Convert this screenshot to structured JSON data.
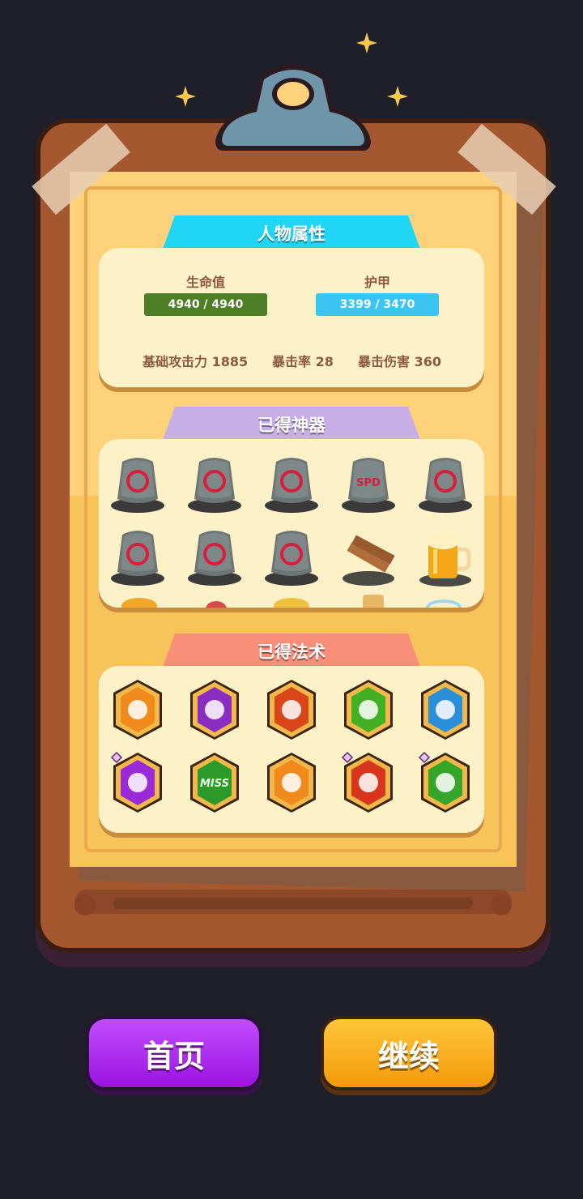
{
  "stats_section": {
    "title": "人物属性",
    "hp_label": "生命值",
    "hp_value": "4940 / 4940",
    "hp_fraction": 1.0,
    "armor_label": "护甲",
    "armor_value": "3399 / 3470",
    "armor_fraction": 0.98,
    "base_attack": "基础攻击力 1885",
    "crit_rate": "暴击率 28",
    "crit_damage": "暴击伤害 360"
  },
  "artifacts_section": {
    "title": "已得神器",
    "items": [
      {
        "icon": "sunrise-rune-icon"
      },
      {
        "icon": "k-rune-icon"
      },
      {
        "icon": "curve-rune-icon"
      },
      {
        "icon": "spd-rune-icon",
        "label": "SPD"
      },
      {
        "icon": "cross-arrows-rune-icon"
      },
      {
        "icon": "moon-rune-icon"
      },
      {
        "icon": "sun-rune-icon"
      },
      {
        "icon": "skull-rune-icon"
      },
      {
        "icon": "wooden-planks-icon"
      },
      {
        "icon": "beer-mug-icon"
      }
    ]
  },
  "spells_section": {
    "title": "已得法术",
    "items": [
      {
        "icon": "lightning-shield-icon",
        "color": "#f08a1c"
      },
      {
        "icon": "arcane-shield-icon",
        "color": "#8a2ec2"
      },
      {
        "icon": "fire-shield-icon",
        "color": "#d8461c"
      },
      {
        "icon": "poison-skull-icon",
        "color": "#42b023"
      },
      {
        "icon": "frost-shield-icon",
        "color": "#2a8fd8"
      },
      {
        "icon": "magic-sparkle-icon",
        "color": "#9a2ad8",
        "gem": true
      },
      {
        "icon": "miss-icon",
        "color": "#2c9a2a",
        "label": "MISS"
      },
      {
        "icon": "crossed-swords-icon",
        "color": "#f08a1c"
      },
      {
        "icon": "fireball-icon",
        "color": "#d8361c",
        "gem": true
      },
      {
        "icon": "sheep-icon",
        "color": "#35a62a",
        "gem": true
      }
    ]
  },
  "buttons": {
    "home": "首页",
    "continue": "继续"
  },
  "colors": {
    "background": "#1f1f29",
    "hp_bar": "#4e7e26",
    "armor_bar": "#3cc4f2",
    "home_button": "#a824e8",
    "continue_button": "#f8a80f"
  }
}
